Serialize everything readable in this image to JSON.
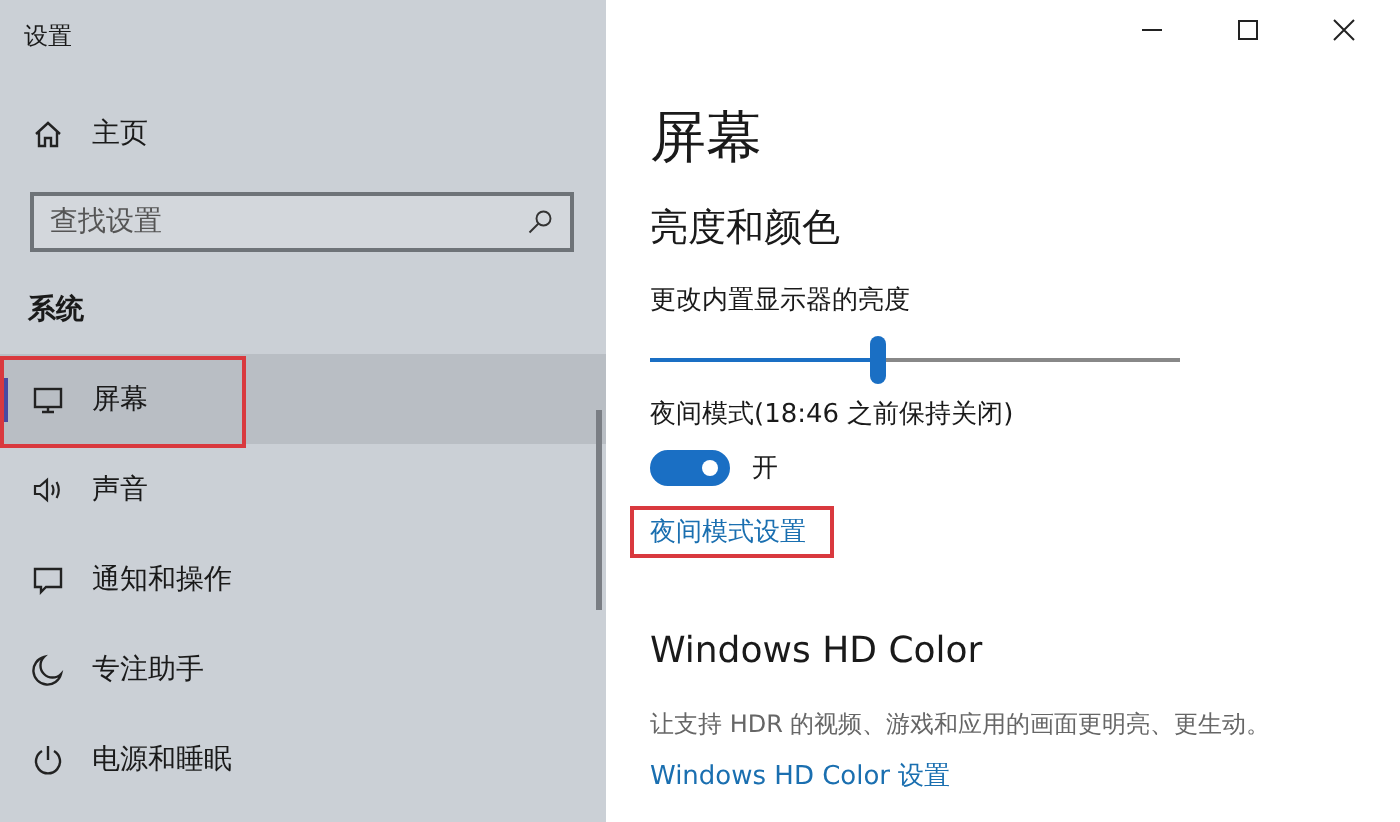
{
  "window": {
    "title": "设置"
  },
  "sidebar": {
    "home": {
      "label": "主页"
    },
    "search": {
      "placeholder": "查找设置"
    },
    "section": "系统",
    "items": [
      {
        "label": "屏幕",
        "kind": "monitor",
        "selected": true,
        "highlighted": true
      },
      {
        "label": "声音",
        "kind": "speaker",
        "selected": false,
        "highlighted": false
      },
      {
        "label": "通知和操作",
        "kind": "message",
        "selected": false,
        "highlighted": false
      },
      {
        "label": "专注助手",
        "kind": "moon",
        "selected": false,
        "highlighted": false
      },
      {
        "label": "电源和睡眠",
        "kind": "power",
        "selected": false,
        "highlighted": false
      }
    ]
  },
  "content": {
    "title": "屏幕",
    "section": "亮度和颜色",
    "brightness": {
      "label": "更改内置显示器的亮度",
      "level": 0.43
    },
    "night_light": {
      "label": "夜间模式(18:46 之前保持关闭)",
      "on": true,
      "state_text": "开"
    },
    "night_settings_link": {
      "label": "夜间模式设置",
      "highlighted": true
    },
    "hd_color": {
      "heading": "Windows HD Color",
      "description": "让支持 HDR 的视频、游戏和应用的画面更明亮、更生动。",
      "link": "Windows HD Color 设置"
    }
  }
}
